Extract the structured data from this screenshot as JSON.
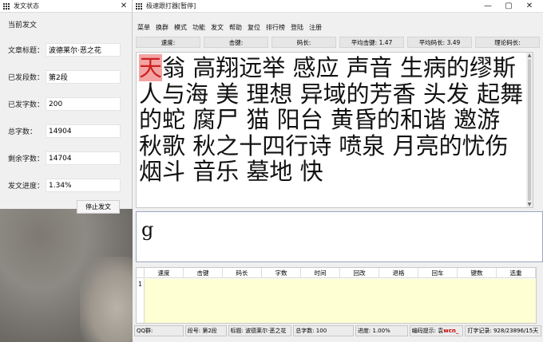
{
  "left_panel": {
    "title": "发文状态",
    "section": "当前发文",
    "fields": [
      {
        "label": "文章标题：",
        "value": "波德莱尔·恶之花"
      },
      {
        "label": "已发段数：",
        "value": "第2段"
      },
      {
        "label": "已发字数：",
        "value": "200"
      },
      {
        "label": "总字数：",
        "value": "14904"
      },
      {
        "label": "剩余字数：",
        "value": "14704"
      },
      {
        "label": "发文进度：",
        "value": "1.34%"
      }
    ],
    "stop_button": "停止发文"
  },
  "main": {
    "title": "极速跟打器[暂停]",
    "controls": {
      "minimize": "—",
      "maximize": "▢",
      "close": "✕"
    },
    "menu": [
      "菜单",
      "换群",
      "模式",
      "功能",
      "发文",
      "帮助",
      "复位",
      "排行榜",
      "登陆",
      "注册"
    ],
    "stats": [
      {
        "label": "速度:"
      },
      {
        "label": "击键:"
      },
      {
        "label": "码长:"
      },
      {
        "label": "平均击键: 1.47"
      },
      {
        "label": "平均码长: 3.49"
      },
      {
        "label": "理论码长:"
      }
    ],
    "text_first": "天",
    "text_rest": "翁 高翔远举 感应 声音 生病的缪斯 人与海 美 理想 异域的芳香 头发 起舞的蛇 腐尸 猫 阳台 黄昏的和谐 邀游 秋歌 秋之十四行诗 喷泉 月亮的忧伤 烟斗 音乐 墓地 快",
    "input_text": "g",
    "grid_columns": [
      "速度",
      "击键",
      "码长",
      "字数",
      "时间",
      "回改",
      "退格",
      "回车",
      "键数",
      "选重"
    ],
    "grid_row": "1",
    "status": [
      "QQ群:",
      "段号: 第2段",
      "标题: 波德莱尔·恶之花",
      "总字数: 100",
      "进度: 1.00%",
      "编码提示: 袁 ",
      "wcn_",
      "打字记录: 928/23896/15天"
    ]
  },
  "colors": {
    "highlight_bg": "#f4a3a3",
    "highlight_fg": "#cc2222",
    "grid_fill": "#ffffd4",
    "input_border": "#9aa6c2"
  }
}
